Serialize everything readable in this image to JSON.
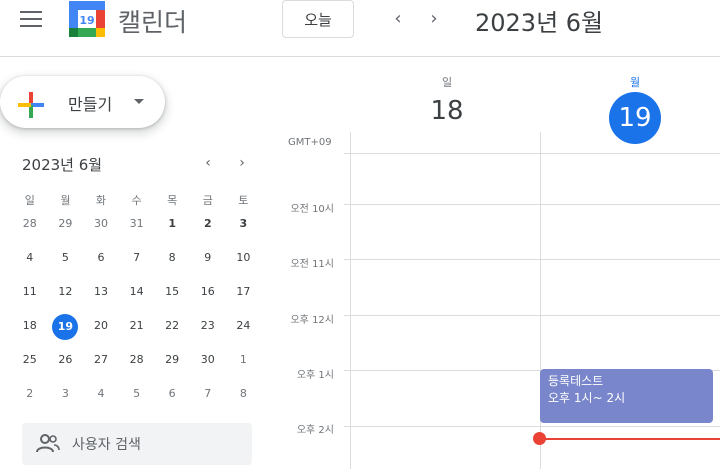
{
  "header": {
    "app_title": "캘린더",
    "logo_day": "19",
    "today_label": "오늘",
    "prev_label": "‹",
    "next_label": "›",
    "month_title": "2023년 6월"
  },
  "create": {
    "label": "만들기"
  },
  "mini_calendar": {
    "title": "2023년 6월",
    "prev_label": "‹",
    "next_label": "›",
    "weekdays": [
      "일",
      "월",
      "화",
      "수",
      "목",
      "금",
      "토"
    ],
    "weeks": [
      [
        "28",
        "29",
        "30",
        "31",
        "1",
        "2",
        "3"
      ],
      [
        "4",
        "5",
        "6",
        "7",
        "8",
        "9",
        "10"
      ],
      [
        "11",
        "12",
        "13",
        "14",
        "15",
        "16",
        "17"
      ],
      [
        "18",
        "19",
        "20",
        "21",
        "22",
        "23",
        "24"
      ],
      [
        "25",
        "26",
        "27",
        "28",
        "29",
        "30",
        "1"
      ],
      [
        "2",
        "3",
        "4",
        "5",
        "6",
        "7",
        "8"
      ]
    ],
    "selected_day": "19"
  },
  "people_search": {
    "placeholder": "사용자 검색"
  },
  "day_columns": [
    {
      "weekday": "일",
      "date": "18",
      "is_today": false
    },
    {
      "weekday": "월",
      "date": "19",
      "is_today": true
    }
  ],
  "timezone": "GMT+09",
  "hours": [
    "오전 10시",
    "오전 11시",
    "오후 12시",
    "오후 1시",
    "오후 2시"
  ],
  "event": {
    "title": "등록테스트",
    "time": "오후 1시~ 2시",
    "color": "#7986cb"
  },
  "colors": {
    "accent": "#1a73e8",
    "now_line": "#ea4335"
  }
}
